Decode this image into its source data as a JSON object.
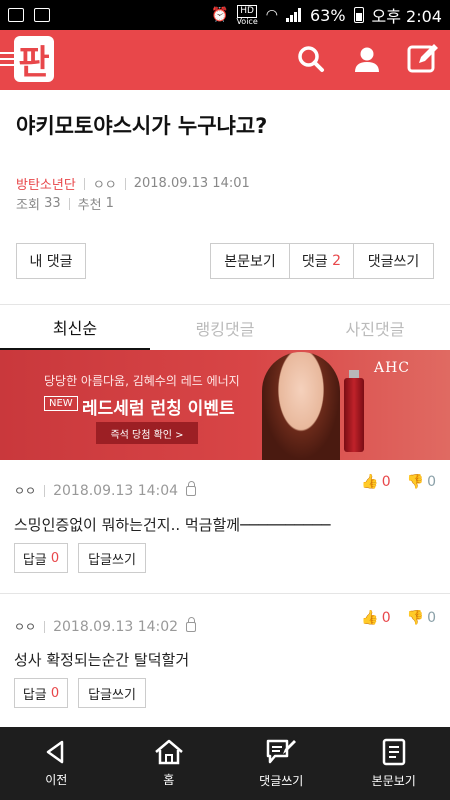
{
  "status_bar": {
    "battery": "63%",
    "time": "오후 2:04",
    "hd_label": "HD",
    "voice_label": "Voice"
  },
  "app_bar": {
    "logo": "판",
    "icons": [
      "menu-icon",
      "search-icon",
      "user-icon",
      "compose-icon"
    ]
  },
  "post": {
    "title": "야키모토야스시가 누구냐고?",
    "author": "방탄소년단",
    "nickname": "ㅇㅇ",
    "datetime": "2018.09.13 14:01",
    "views_label": "조회",
    "views": "33",
    "likes_label": "추천",
    "likes": "1"
  },
  "actions": {
    "my_comments": "내 댓글",
    "view_post": "본문보기",
    "comments_label": "댓글",
    "comments_count": "2",
    "write_comment": "댓글쓰기"
  },
  "tabs": [
    {
      "label": "최신순",
      "active": true
    },
    {
      "label": "랭킹댓글",
      "active": false
    },
    {
      "label": "사진댓글",
      "active": false
    }
  ],
  "ad": {
    "line1": "당당한 아름다움, 김혜수의 레드 에너지",
    "badge": "NEW",
    "line2": "레드세럼 런칭 이벤트",
    "cta": "즉석 당첨 확인 >",
    "brand": "AHC"
  },
  "comments": [
    {
      "author": "ㅇㅇ",
      "date": "2018.09.13 14:04",
      "text": "스밍인증없이 뭐하는건지.. 먹금할께──────────",
      "up": "0",
      "down": "0",
      "reply_label": "답글",
      "reply_count": "0",
      "write_reply": "답글쓰기"
    },
    {
      "author": "ㅇㅇ",
      "date": "2018.09.13 14:02",
      "text": "성사 확정되는순간 탈덕할거",
      "up": "0",
      "down": "0",
      "reply_label": "답글",
      "reply_count": "0",
      "write_reply": "답글쓰기"
    }
  ],
  "bottom_nav": [
    {
      "label": "이전",
      "icon": "back-icon"
    },
    {
      "label": "홈",
      "icon": "home-icon"
    },
    {
      "label": "댓글쓰기",
      "icon": "comment-write-icon"
    },
    {
      "label": "본문보기",
      "icon": "document-icon"
    }
  ],
  "colors": {
    "brand_red": "#e8474a",
    "bottom_bar": "#1e1e1e"
  }
}
